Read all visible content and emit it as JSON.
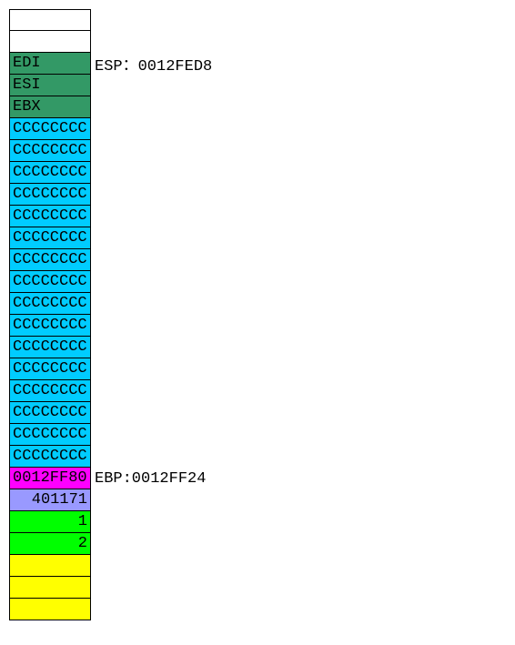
{
  "stack": [
    {
      "value": "",
      "bg": "bg-white",
      "align": "align-left",
      "label": ""
    },
    {
      "value": "",
      "bg": "bg-white",
      "align": "align-left",
      "label": ""
    },
    {
      "value": "EDI",
      "bg": "bg-green",
      "align": "align-left",
      "label": "ESP：0012FED8"
    },
    {
      "value": "ESI",
      "bg": "bg-green",
      "align": "align-left",
      "label": ""
    },
    {
      "value": "EBX",
      "bg": "bg-green",
      "align": "align-left",
      "label": ""
    },
    {
      "value": "CCCCCCCC",
      "bg": "bg-cyan",
      "align": "align-left",
      "label": ""
    },
    {
      "value": "CCCCCCCC",
      "bg": "bg-cyan",
      "align": "align-left",
      "label": ""
    },
    {
      "value": "CCCCCCCC",
      "bg": "bg-cyan",
      "align": "align-left",
      "label": ""
    },
    {
      "value": "CCCCCCCC",
      "bg": "bg-cyan",
      "align": "align-left",
      "label": ""
    },
    {
      "value": "CCCCCCCC",
      "bg": "bg-cyan",
      "align": "align-left",
      "label": ""
    },
    {
      "value": "CCCCCCCC",
      "bg": "bg-cyan",
      "align": "align-left",
      "label": ""
    },
    {
      "value": "CCCCCCCC",
      "bg": "bg-cyan",
      "align": "align-left",
      "label": ""
    },
    {
      "value": "CCCCCCCC",
      "bg": "bg-cyan",
      "align": "align-left",
      "label": ""
    },
    {
      "value": "CCCCCCCC",
      "bg": "bg-cyan",
      "align": "align-left",
      "label": ""
    },
    {
      "value": "CCCCCCCC",
      "bg": "bg-cyan",
      "align": "align-left",
      "label": ""
    },
    {
      "value": "CCCCCCCC",
      "bg": "bg-cyan",
      "align": "align-left",
      "label": ""
    },
    {
      "value": "CCCCCCCC",
      "bg": "bg-cyan",
      "align": "align-left",
      "label": ""
    },
    {
      "value": "CCCCCCCC",
      "bg": "bg-cyan",
      "align": "align-left",
      "label": ""
    },
    {
      "value": "CCCCCCCC",
      "bg": "bg-cyan",
      "align": "align-left",
      "label": ""
    },
    {
      "value": "CCCCCCCC",
      "bg": "bg-cyan",
      "align": "align-left",
      "label": ""
    },
    {
      "value": "CCCCCCCC",
      "bg": "bg-cyan",
      "align": "align-left",
      "label": ""
    },
    {
      "value": "0012FF80",
      "bg": "bg-magenta",
      "align": "align-left",
      "label": "EBP:0012FF24"
    },
    {
      "value": "401171",
      "bg": "bg-violet",
      "align": "align-right",
      "label": ""
    },
    {
      "value": "1",
      "bg": "bg-lime",
      "align": "align-right",
      "label": ""
    },
    {
      "value": "2",
      "bg": "bg-lime",
      "align": "align-right",
      "label": ""
    },
    {
      "value": "",
      "bg": "bg-yellow",
      "align": "align-left",
      "label": ""
    },
    {
      "value": "",
      "bg": "bg-yellow",
      "align": "align-left",
      "label": ""
    },
    {
      "value": "",
      "bg": "bg-yellow",
      "align": "align-left",
      "label": ""
    }
  ]
}
